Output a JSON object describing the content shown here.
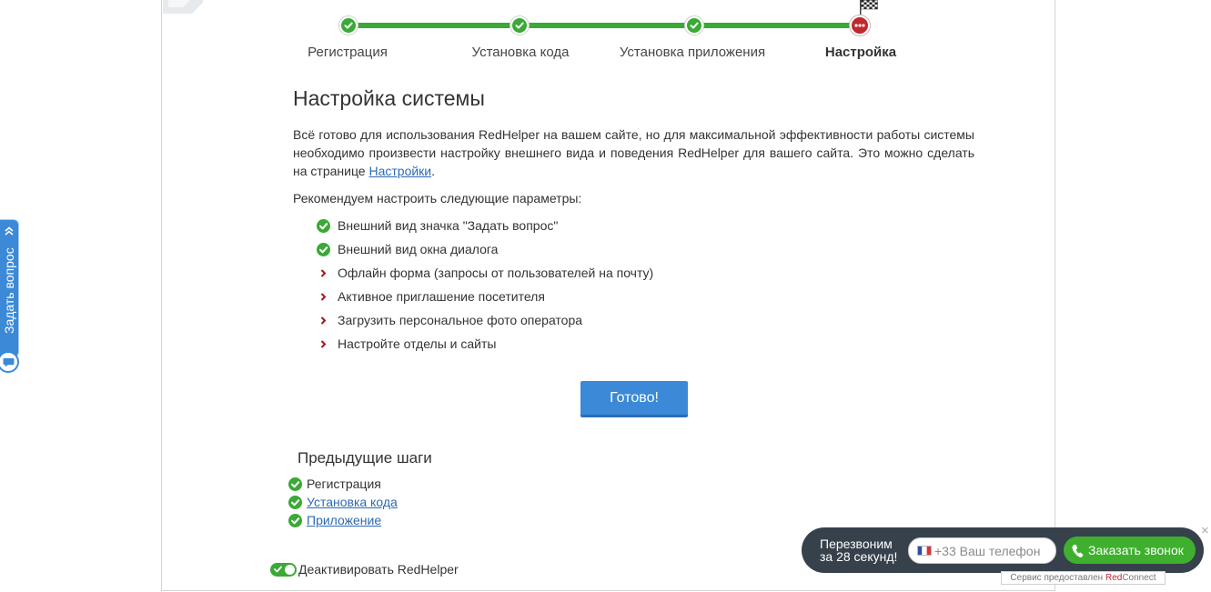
{
  "progress": {
    "steps": [
      {
        "label": "Регистрация",
        "status": "done"
      },
      {
        "label": "Установка кода",
        "status": "done"
      },
      {
        "label": "Установка приложения",
        "status": "done"
      },
      {
        "label": "Настройка",
        "status": "current"
      }
    ],
    "finish_icon": "checkered-flag-icon"
  },
  "main": {
    "title": "Настройка системы",
    "intro_text": "Всё готово для использования RedHelper на вашем сайте, но для максимальной эффективности работы системы необходимо произвести настройку внешнего вида и поведения RedHelper для вашего сайта. Это можно сделать на странице ",
    "intro_link": "Настройки",
    "intro_end": ".",
    "recommend_label": "Рекомендуем настроить следующие параметры:",
    "checklist": [
      {
        "label": "Внешний вид значка \"Задать вопрос\"",
        "status": "done"
      },
      {
        "label": "Внешний вид окна диалога",
        "status": "done"
      },
      {
        "label": "Офлайн форма (запросы от пользователей на почту)",
        "status": "todo"
      },
      {
        "label": "Активное приглашение посетителя",
        "status": "todo"
      },
      {
        "label": "Загрузить персональное фото оператора",
        "status": "todo"
      },
      {
        "label": "Настройте отделы и сайты",
        "status": "todo"
      }
    ],
    "done_button": "Готово!"
  },
  "previous_steps": {
    "title": "Предыдущие шаги",
    "items": [
      {
        "label": "Регистрация",
        "is_link": false
      },
      {
        "label": "Установка кода",
        "is_link": true
      },
      {
        "label": "Приложение",
        "is_link": true
      }
    ]
  },
  "deactivate": {
    "label": "Деактивировать RedHelper",
    "toggle_on": true
  },
  "side_widget": {
    "label": "Задать вопрос",
    "arrow_icon": "double-chevron-icon",
    "chat_icon": "chat-bubble-icon"
  },
  "callback_widget": {
    "text_line1": "Перезвоним",
    "text_line2": "за 28 секунд!",
    "phone_placeholder": "+33 Ваш телефон",
    "country_icon": "france-flag-icon",
    "button_label": "Заказать звонок",
    "button_icon": "phone-icon",
    "credit_prefix": "Сервис предоставлен ",
    "credit_brand_red": "Red",
    "credit_brand_rest": "Connect",
    "close_icon": "close-icon"
  },
  "colors": {
    "success_green": "#3aa935",
    "current_red": "#c0282e",
    "primary_blue": "#3b89d7",
    "link_blue": "#2d6ab3",
    "widget_dark": "#36414b",
    "bullet_red": "#a3161f"
  }
}
